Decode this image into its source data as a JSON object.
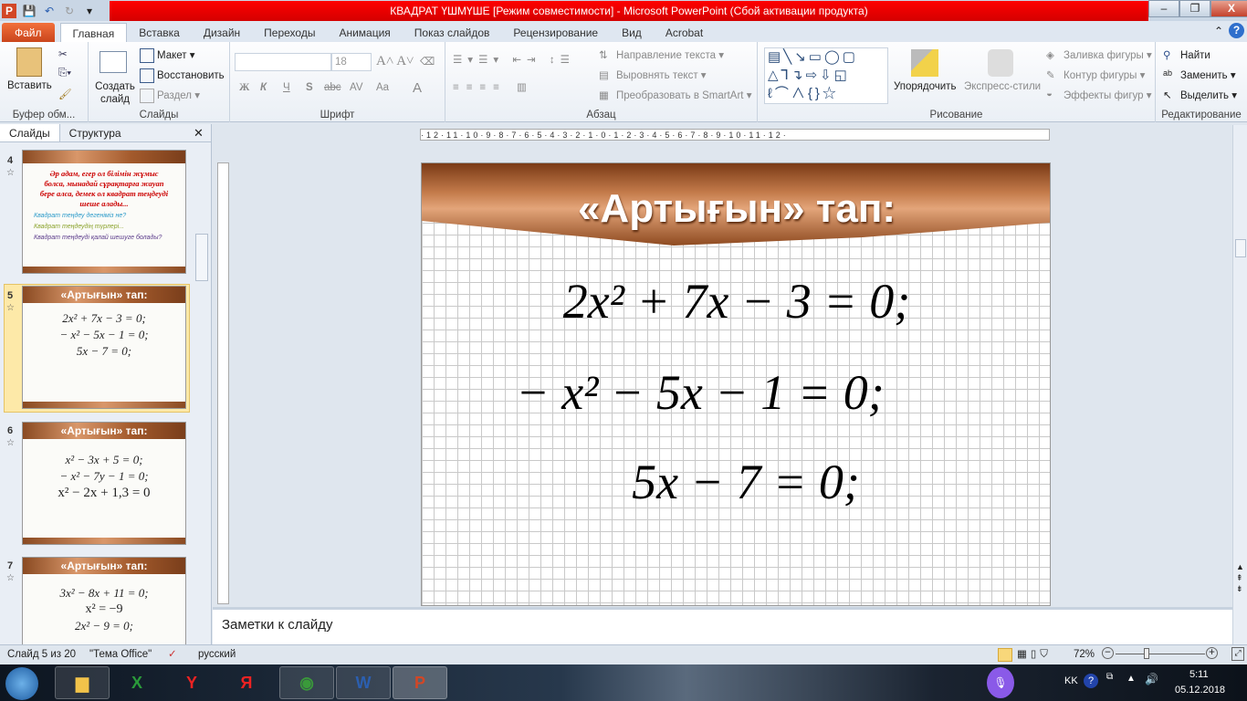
{
  "window": {
    "title": "КВАДРАТ ҮШМҮШЕ [Режим совместимости]  -  Microsoft PowerPoint (Сбой активации продукта)",
    "minimize": "–",
    "restore": "❐",
    "close": "X"
  },
  "tabs": [
    "Файл",
    "Главная",
    "Вставка",
    "Дизайн",
    "Переходы",
    "Анимация",
    "Показ слайдов",
    "Рецензирование",
    "Вид",
    "Acrobat"
  ],
  "ribbon": {
    "clipboard": {
      "paste": "Вставить",
      "label": "Буфер обм..."
    },
    "slides": {
      "new_slide": "Создать слайд",
      "layout": "Макет",
      "reset": "Восстановить",
      "section": "Раздел",
      "label": "Слайды"
    },
    "font": {
      "font_name": "",
      "font_size": "18",
      "bold": "Ж",
      "italic": "К",
      "underline": "Ч",
      "shadow": "S",
      "strike": "abc",
      "spacing": "AV",
      "case": "Aa",
      "color": "A",
      "label": "Шрифт"
    },
    "paragraph": {
      "text_direction": "Направление текста",
      "align_text": "Выровнять текст",
      "smartart": "Преобразовать в SmartArt",
      "label": "Абзац"
    },
    "drawing": {
      "arrange": "Упорядочить",
      "quick_styles": "Экспресс-стили",
      "fill": "Заливка фигуры",
      "outline": "Контур фигуры",
      "effects": "Эффекты фигур",
      "label": "Рисование"
    },
    "editing": {
      "find": "Найти",
      "replace": "Заменить",
      "select": "Выделить",
      "label": "Редактирование"
    }
  },
  "panel": {
    "tabs": [
      "Слайды",
      "Структура"
    ],
    "close": "✕"
  },
  "thumbnails": [
    {
      "num": "4",
      "lines": [
        "Әр адам, егер ол білімін жұмыс",
        "болса, мынадай сұрақтарға жауап",
        "бере алса, демек ол квадрат теңдеуді",
        "шеше алады..."
      ],
      "bullets": [
        "Квадрат теңдеу дегеніміз не?",
        "Квадрат теңдеудің түрлері...",
        "Квадрат теңдеуді қалай шешуге болады?"
      ]
    },
    {
      "num": "5",
      "title": "«Артығын»  тап:",
      "eqs": [
        "2x² + 7x − 3 = 0;",
        "− x² − 5x − 1 = 0;",
        "5x − 7 = 0;"
      ]
    },
    {
      "num": "6",
      "title": "«Артығын»  тап:",
      "eqs": [
        "x² − 3x + 5 = 0;",
        "− x² − 7y − 1 = 0;",
        "x² − 2x + 1,3 = 0"
      ]
    },
    {
      "num": "7",
      "title": "«Артығын»  тап:",
      "eqs": [
        "3x² − 8x + 11 = 0;",
        "x² = −9",
        "2x² − 9 = 0;"
      ]
    }
  ],
  "ruler": {
    "horizontal": "·12·11·10·9·8·7·6·5·4·3·2·1·0·1·2·3·4·5·6·7·8·9·10·11·12·"
  },
  "slide": {
    "title": "«Артығын»  тап:",
    "equations": [
      "2x² + 7x − 3 = 0;",
      "− x² − 5x − 1 = 0;",
      "5x − 7 = 0;"
    ]
  },
  "notes": {
    "placeholder": "Заметки к слайду"
  },
  "status": {
    "slide": "Слайд 5 из 20",
    "theme": "\"Тема Office\"",
    "language": "русский",
    "zoom": "72%",
    "zoom_value": 72
  },
  "taskbar": {
    "language": "KK",
    "time": "5:11",
    "date": "05.12.2018"
  }
}
